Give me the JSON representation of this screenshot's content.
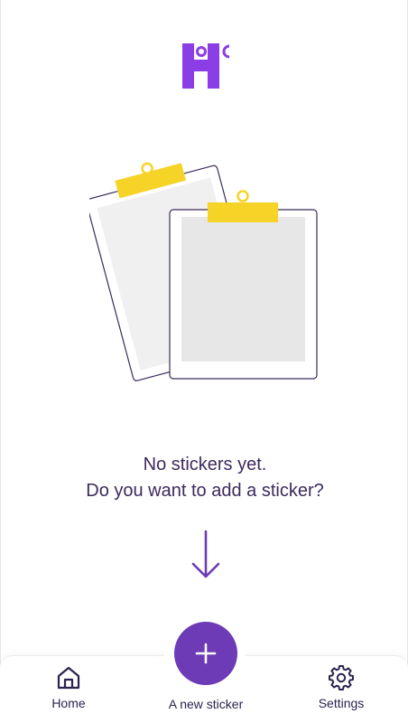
{
  "empty_state": {
    "line1": "No stickers yet.",
    "line2": "Do you want to add a sticker?"
  },
  "tabbar": {
    "home_label": "Home",
    "new_sticker_label": "A new sticker",
    "settings_label": "Settings"
  },
  "icons": {
    "logo": "app-logo-icon",
    "illustration": "clipboards-illustration",
    "arrow": "arrow-down-icon",
    "home": "home-icon",
    "plus": "plus-icon",
    "settings": "gear-icon"
  },
  "colors": {
    "brand": "#6c3bb5",
    "text": "#3b2a5c",
    "clip": "#f6d327"
  }
}
